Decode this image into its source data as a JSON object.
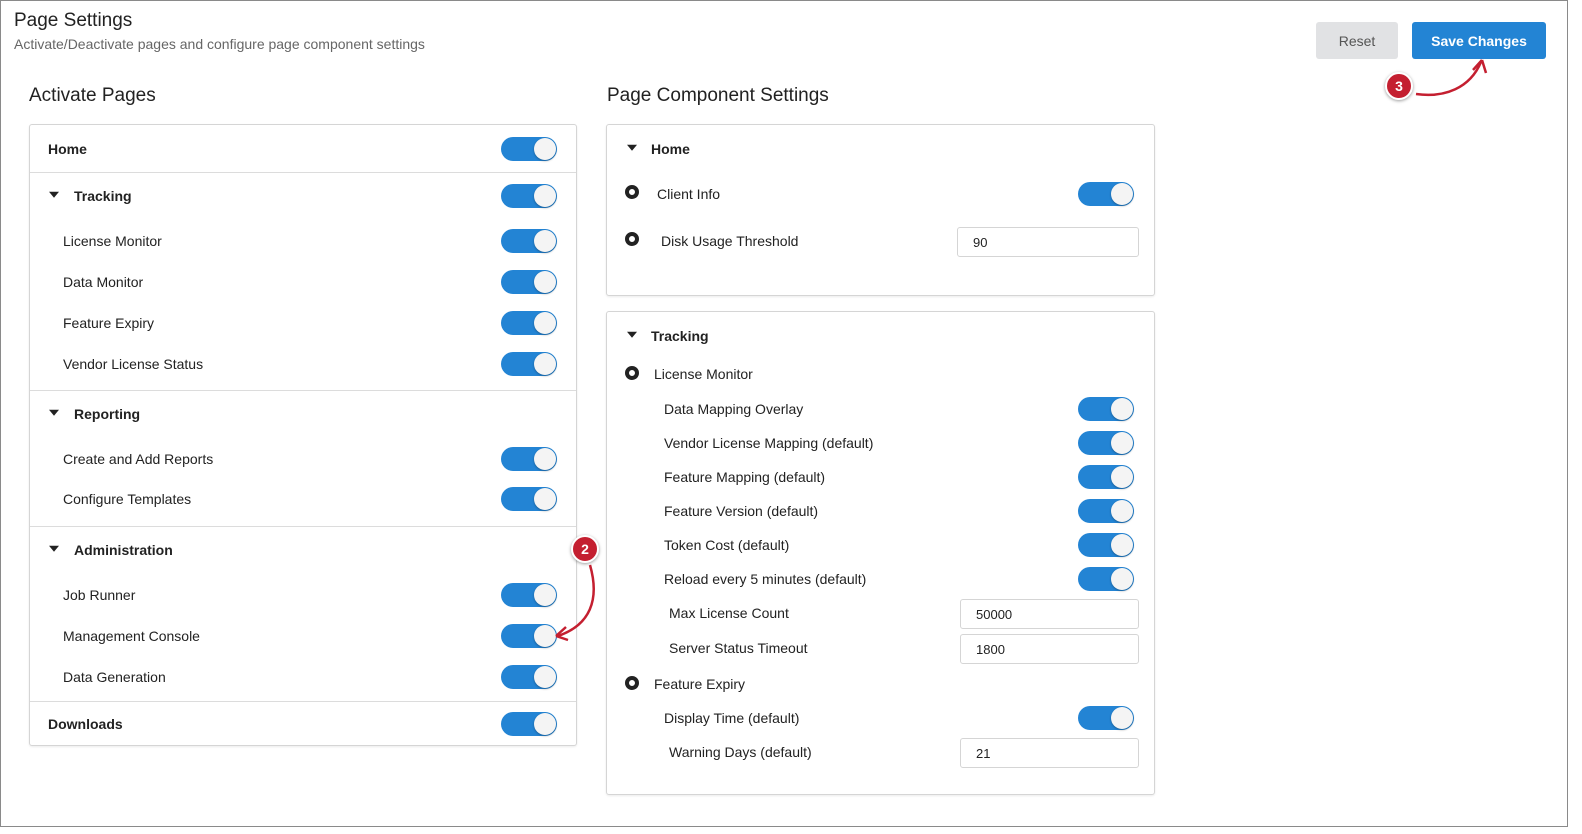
{
  "header": {
    "title": "Page Settings",
    "subtitle": "Activate/Deactivate pages and configure page component settings",
    "reset_label": "Reset",
    "save_label": "Save Changes"
  },
  "activate_pages": {
    "heading": "Activate Pages",
    "home": "Home",
    "tracking": {
      "label": "Tracking",
      "items": [
        "License Monitor",
        "Data Monitor",
        "Feature Expiry",
        "Vendor License Status"
      ]
    },
    "reporting": {
      "label": "Reporting",
      "items": [
        "Create and Add Reports",
        "Configure Templates"
      ]
    },
    "administration": {
      "label": "Administration",
      "items": [
        "Job Runner",
        "Management Console",
        "Data Generation"
      ]
    },
    "downloads": "Downloads"
  },
  "component_settings": {
    "heading": "Page Component Settings",
    "home": {
      "label": "Home",
      "client_info": "Client Info",
      "disk_label": "Disk Usage Threshold",
      "disk_value": "90"
    },
    "tracking": {
      "label": "Tracking",
      "license_monitor": "License Monitor",
      "lm_toggles": [
        "Data Mapping Overlay",
        "Vendor License Mapping (default)",
        "Feature Mapping (default)",
        "Feature Version (default)",
        "Token Cost (default)",
        "Reload every 5 minutes (default)"
      ],
      "max_license_label": "Max License Count",
      "max_license_value": "50000",
      "server_timeout_label": "Server Status Timeout",
      "server_timeout_value": "1800",
      "feature_expiry": "Feature Expiry",
      "display_time": "Display Time (default)",
      "warning_days_label": "Warning Days (default)",
      "warning_days_value": "21"
    }
  },
  "annotations": {
    "step2": "2",
    "step3": "3"
  },
  "colors": {
    "accent": "#2384d4",
    "annotation": "#c41f30"
  }
}
